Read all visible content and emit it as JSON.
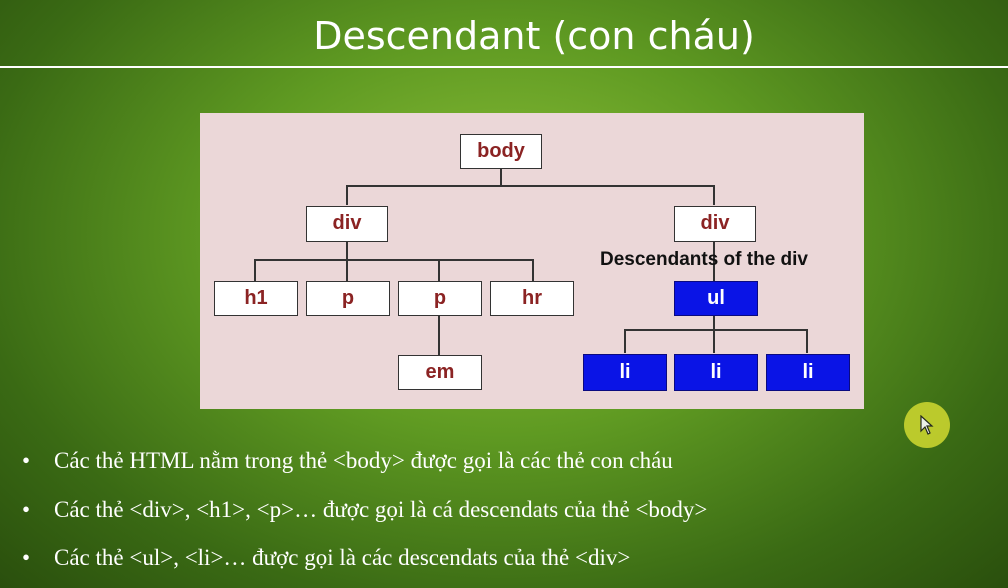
{
  "slide": {
    "title": "Descendant (con cháu)"
  },
  "diagram": {
    "nodes": {
      "body": "body",
      "div_left": "div",
      "div_right": "div",
      "h1": "h1",
      "p1": "p",
      "p2": "p",
      "hr": "hr",
      "em": "em",
      "ul": "ul",
      "li1": "li",
      "li2": "li",
      "li3": "li"
    },
    "descendants_label": "Descendants of the div",
    "colors": {
      "background": "#ebd7d8",
      "node_text": "#8b2323",
      "highlight": "#0a14e6"
    }
  },
  "bullets": [
    "Các thẻ HTML nằm trong thẻ  <body> được gọi là các thẻ con cháu",
    "Các thẻ <div>, <h1>, <p>… được gọi là cá descendats của thẻ <body>",
    "Các thẻ <ul>, <li>… được gọi là các descendats của thẻ <div>"
  ],
  "bullet_symbol": "•",
  "cursor_icon": "mouse-pointer-icon"
}
